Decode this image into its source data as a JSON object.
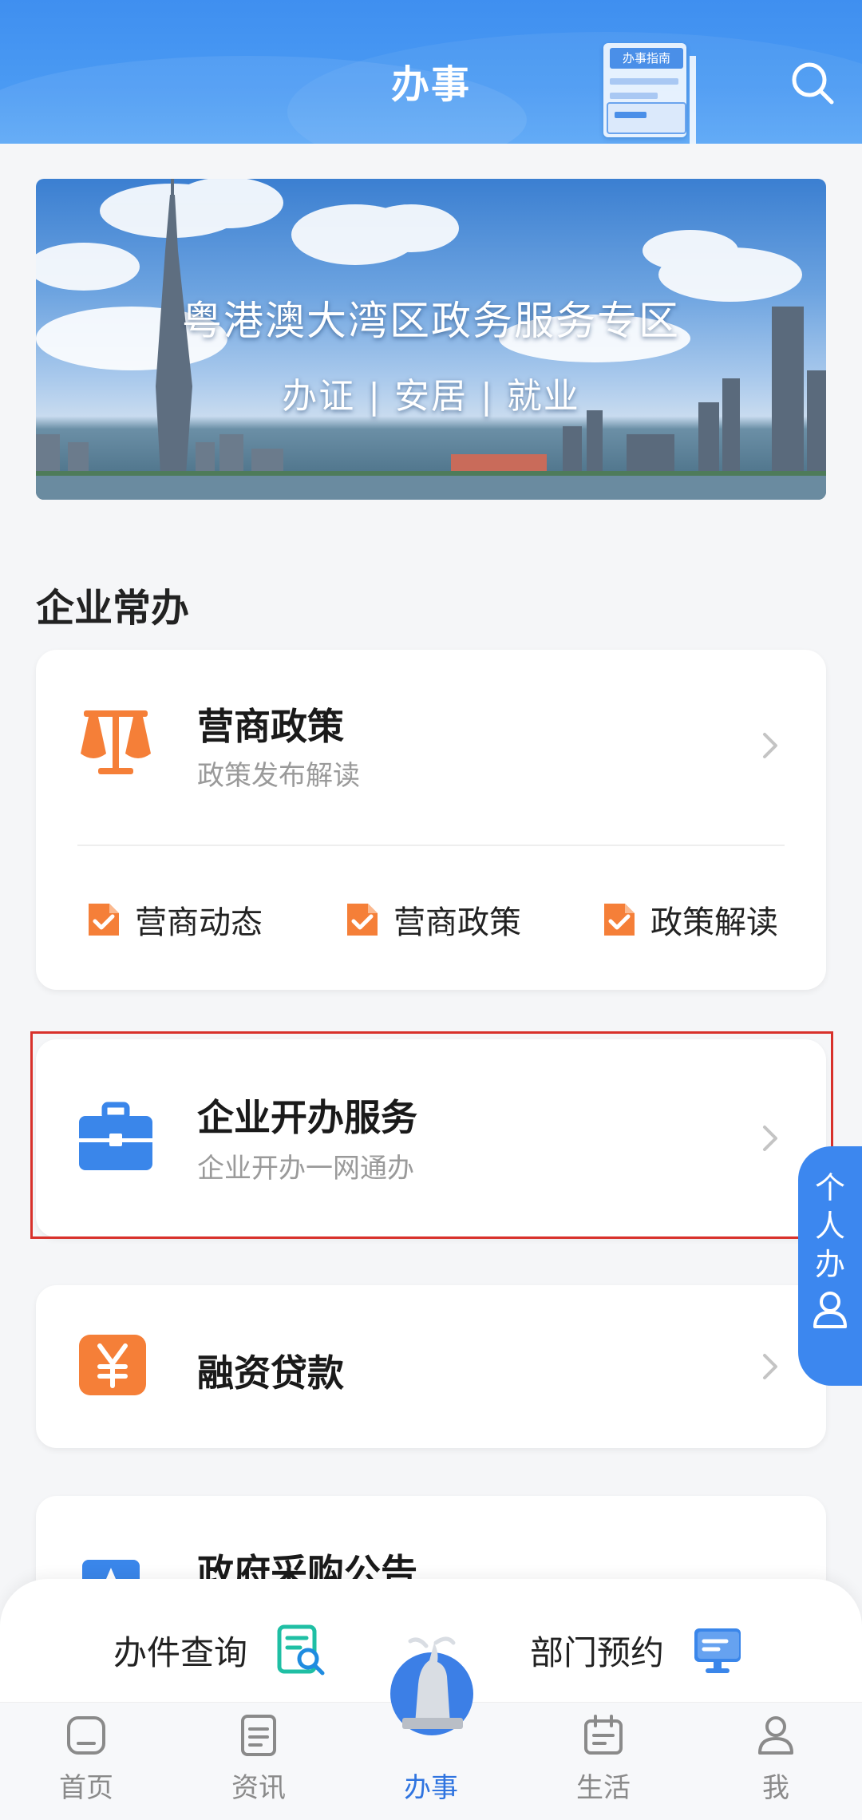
{
  "header": {
    "title": "办事",
    "guide_badge": "办事指南",
    "search_icon": "search-icon",
    "color": "#4a9af3"
  },
  "banner": {
    "title": "粤港澳大湾区政务服务专区",
    "subtitle": "办证 | 安居 | 就业"
  },
  "section": {
    "title": "企业常办"
  },
  "cards": {
    "policy": {
      "title": "营商政策",
      "subtitle": "政策发布解读",
      "icon": "scales-icon",
      "links": [
        "营商动态",
        "营商政策",
        "政策解读"
      ]
    },
    "startup": {
      "title": "企业开办服务",
      "subtitle": "企业开办一网通办",
      "icon": "briefcase-icon"
    },
    "finance": {
      "title": "融资贷款",
      "icon": "yen-icon"
    },
    "procurement": {
      "title": "政府采购公告"
    }
  },
  "float_tab": {
    "chars": [
      "个",
      "人",
      "办"
    ],
    "icon": "person-icon"
  },
  "quick_actions": {
    "query": "办件查询",
    "appointment": "部门预约"
  },
  "tabbar": {
    "items": [
      {
        "label": "首页",
        "icon": "home-icon"
      },
      {
        "label": "资讯",
        "icon": "news-icon"
      },
      {
        "label": "办事",
        "icon": "goat-statue-icon"
      },
      {
        "label": "生活",
        "icon": "calendar-icon"
      },
      {
        "label": "我",
        "icon": "user-icon"
      }
    ],
    "active_color": "#2f74e0",
    "inactive_color": "#8a8a8a"
  }
}
